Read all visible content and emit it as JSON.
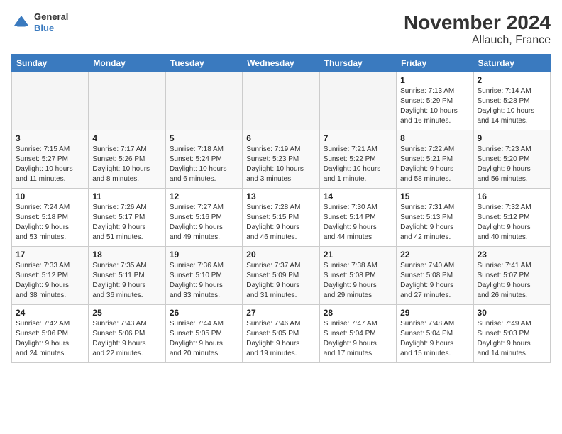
{
  "header": {
    "logo_line1": "General",
    "logo_line2": "Blue",
    "title": "November 2024",
    "subtitle": "Allauch, France"
  },
  "weekdays": [
    "Sunday",
    "Monday",
    "Tuesday",
    "Wednesday",
    "Thursday",
    "Friday",
    "Saturday"
  ],
  "weeks": [
    [
      {
        "day": "",
        "info": ""
      },
      {
        "day": "",
        "info": ""
      },
      {
        "day": "",
        "info": ""
      },
      {
        "day": "",
        "info": ""
      },
      {
        "day": "",
        "info": ""
      },
      {
        "day": "1",
        "info": "Sunrise: 7:13 AM\nSunset: 5:29 PM\nDaylight: 10 hours\nand 16 minutes."
      },
      {
        "day": "2",
        "info": "Sunrise: 7:14 AM\nSunset: 5:28 PM\nDaylight: 10 hours\nand 14 minutes."
      }
    ],
    [
      {
        "day": "3",
        "info": "Sunrise: 7:15 AM\nSunset: 5:27 PM\nDaylight: 10 hours\nand 11 minutes."
      },
      {
        "day": "4",
        "info": "Sunrise: 7:17 AM\nSunset: 5:26 PM\nDaylight: 10 hours\nand 8 minutes."
      },
      {
        "day": "5",
        "info": "Sunrise: 7:18 AM\nSunset: 5:24 PM\nDaylight: 10 hours\nand 6 minutes."
      },
      {
        "day": "6",
        "info": "Sunrise: 7:19 AM\nSunset: 5:23 PM\nDaylight: 10 hours\nand 3 minutes."
      },
      {
        "day": "7",
        "info": "Sunrise: 7:21 AM\nSunset: 5:22 PM\nDaylight: 10 hours\nand 1 minute."
      },
      {
        "day": "8",
        "info": "Sunrise: 7:22 AM\nSunset: 5:21 PM\nDaylight: 9 hours\nand 58 minutes."
      },
      {
        "day": "9",
        "info": "Sunrise: 7:23 AM\nSunset: 5:20 PM\nDaylight: 9 hours\nand 56 minutes."
      }
    ],
    [
      {
        "day": "10",
        "info": "Sunrise: 7:24 AM\nSunset: 5:18 PM\nDaylight: 9 hours\nand 53 minutes."
      },
      {
        "day": "11",
        "info": "Sunrise: 7:26 AM\nSunset: 5:17 PM\nDaylight: 9 hours\nand 51 minutes."
      },
      {
        "day": "12",
        "info": "Sunrise: 7:27 AM\nSunset: 5:16 PM\nDaylight: 9 hours\nand 49 minutes."
      },
      {
        "day": "13",
        "info": "Sunrise: 7:28 AM\nSunset: 5:15 PM\nDaylight: 9 hours\nand 46 minutes."
      },
      {
        "day": "14",
        "info": "Sunrise: 7:30 AM\nSunset: 5:14 PM\nDaylight: 9 hours\nand 44 minutes."
      },
      {
        "day": "15",
        "info": "Sunrise: 7:31 AM\nSunset: 5:13 PM\nDaylight: 9 hours\nand 42 minutes."
      },
      {
        "day": "16",
        "info": "Sunrise: 7:32 AM\nSunset: 5:12 PM\nDaylight: 9 hours\nand 40 minutes."
      }
    ],
    [
      {
        "day": "17",
        "info": "Sunrise: 7:33 AM\nSunset: 5:12 PM\nDaylight: 9 hours\nand 38 minutes."
      },
      {
        "day": "18",
        "info": "Sunrise: 7:35 AM\nSunset: 5:11 PM\nDaylight: 9 hours\nand 36 minutes."
      },
      {
        "day": "19",
        "info": "Sunrise: 7:36 AM\nSunset: 5:10 PM\nDaylight: 9 hours\nand 33 minutes."
      },
      {
        "day": "20",
        "info": "Sunrise: 7:37 AM\nSunset: 5:09 PM\nDaylight: 9 hours\nand 31 minutes."
      },
      {
        "day": "21",
        "info": "Sunrise: 7:38 AM\nSunset: 5:08 PM\nDaylight: 9 hours\nand 29 minutes."
      },
      {
        "day": "22",
        "info": "Sunrise: 7:40 AM\nSunset: 5:08 PM\nDaylight: 9 hours\nand 27 minutes."
      },
      {
        "day": "23",
        "info": "Sunrise: 7:41 AM\nSunset: 5:07 PM\nDaylight: 9 hours\nand 26 minutes."
      }
    ],
    [
      {
        "day": "24",
        "info": "Sunrise: 7:42 AM\nSunset: 5:06 PM\nDaylight: 9 hours\nand 24 minutes."
      },
      {
        "day": "25",
        "info": "Sunrise: 7:43 AM\nSunset: 5:06 PM\nDaylight: 9 hours\nand 22 minutes."
      },
      {
        "day": "26",
        "info": "Sunrise: 7:44 AM\nSunset: 5:05 PM\nDaylight: 9 hours\nand 20 minutes."
      },
      {
        "day": "27",
        "info": "Sunrise: 7:46 AM\nSunset: 5:05 PM\nDaylight: 9 hours\nand 19 minutes."
      },
      {
        "day": "28",
        "info": "Sunrise: 7:47 AM\nSunset: 5:04 PM\nDaylight: 9 hours\nand 17 minutes."
      },
      {
        "day": "29",
        "info": "Sunrise: 7:48 AM\nSunset: 5:04 PM\nDaylight: 9 hours\nand 15 minutes."
      },
      {
        "day": "30",
        "info": "Sunrise: 7:49 AM\nSunset: 5:03 PM\nDaylight: 9 hours\nand 14 minutes."
      }
    ]
  ]
}
